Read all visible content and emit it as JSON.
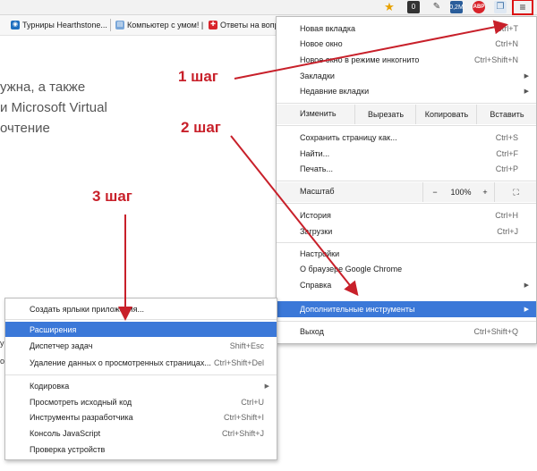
{
  "toolbar": {
    "icons": [
      "star-icon",
      "extension-icon",
      "pin-icon",
      "news-extension-icon",
      "adblock-plus-icon",
      "notes-extension-icon",
      "menu-icon"
    ],
    "badges": {
      "ext1": "0",
      "ext3": "0,2M",
      "abp": "ABP"
    }
  },
  "bookmarks": [
    {
      "label": "Турниры Hearthstone..."
    },
    {
      "label": "Компьютер с умом! |"
    },
    {
      "label": "Ответы на вопр"
    }
  ],
  "page": {
    "lines": [
      "ужна, а также",
      "и Microsoft Virtual",
      "очтение"
    ],
    "small": [
      "у",
      "о"
    ]
  },
  "main_menu": {
    "items_top": [
      {
        "label": "Новая вкладка",
        "shortcut": "Ctrl+T"
      },
      {
        "label": "Новое окно",
        "shortcut": "Ctrl+N"
      },
      {
        "label": "Новое окно в режиме инкогнито",
        "shortcut": "Ctrl+Shift+N"
      },
      {
        "label": "Закладки",
        "shortcut": ""
      },
      {
        "label": "Недавние вкладки",
        "shortcut": ""
      }
    ],
    "edit": {
      "label": "Изменить",
      "cut": "Вырезать",
      "copy": "Копировать",
      "paste": "Вставить"
    },
    "items_mid": [
      {
        "label": "Сохранить страницу как...",
        "shortcut": "Ctrl+S"
      },
      {
        "label": "Найти...",
        "shortcut": "Ctrl+F"
      },
      {
        "label": "Печать...",
        "shortcut": "Ctrl+P"
      }
    ],
    "zoom": {
      "label": "Масштаб",
      "minus": "−",
      "value": "100%",
      "plus": "+",
      "fullscreen": "⛶"
    },
    "items_history": [
      {
        "label": "История",
        "shortcut": "Ctrl+H"
      },
      {
        "label": "Загрузки",
        "shortcut": "Ctrl+J"
      }
    ],
    "items_settings": [
      {
        "label": "Настройки",
        "shortcut": ""
      },
      {
        "label": "О браузере Google Chrome",
        "shortcut": ""
      },
      {
        "label": "Справка",
        "shortcut": ""
      },
      {
        "label": "Дополнительные инструменты",
        "shortcut": ""
      }
    ],
    "exit": {
      "label": "Выход",
      "shortcut": "Ctrl+Shift+Q"
    }
  },
  "sub_menu": {
    "items": [
      {
        "label": "Создать ярлыки приложения...",
        "shortcut": ""
      },
      {
        "label": "Расширения",
        "shortcut": ""
      },
      {
        "label": "Диспетчер задач",
        "shortcut": "Shift+Esc"
      },
      {
        "label": "Удаление данных о просмотренных страницах...",
        "shortcut": "Ctrl+Shift+Del"
      },
      {
        "label": "Кодировка",
        "shortcut": ""
      },
      {
        "label": "Просмотреть исходный код",
        "shortcut": "Ctrl+U"
      },
      {
        "label": "Инструменты разработчика",
        "shortcut": "Ctrl+Shift+I"
      },
      {
        "label": "Консоль JavaScript",
        "shortcut": "Ctrl+Shift+J"
      },
      {
        "label": "Проверка устройств",
        "shortcut": ""
      }
    ]
  },
  "annotations": {
    "step1": "1 шаг",
    "step2": "2 шаг",
    "step3": "3 шаг"
  },
  "colors": {
    "highlight": "#3b78d8",
    "annotation": "#c8202a",
    "menu_bg": "#ffffff",
    "row_bg": "#f4f4f4"
  }
}
